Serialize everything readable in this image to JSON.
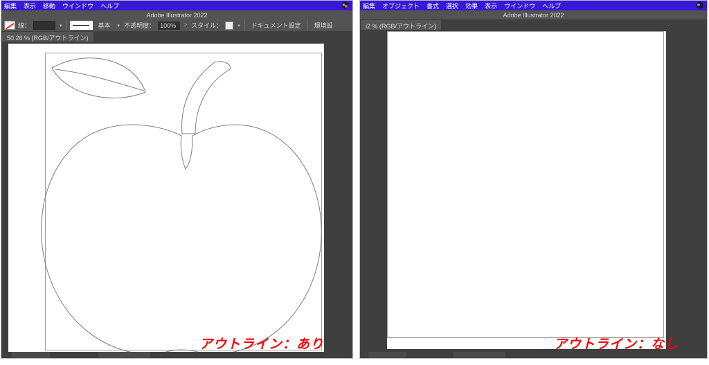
{
  "app_title": "Adobe Illustrator 2022",
  "left": {
    "menus": [
      "編集",
      "表示",
      "移動",
      "ウインドウ",
      "ヘルプ"
    ],
    "doc_tab": "50.26 % (RGB/アウトライン)",
    "opt": {
      "stroke_lbl": "線：",
      "stroke_val": "",
      "basic": "基本",
      "opacity_lbl": "不透明度：",
      "opacity_val": "100%",
      "style_lbl": "スタイル：",
      "docset": "ドキュメント設定",
      "env": "環境設"
    },
    "caption": "アウトライン：あり"
  },
  "right": {
    "menus": [
      "編集",
      "オブジェクト",
      "書式",
      "選択",
      "効果",
      "表示",
      "ウインドウ",
      "ヘルプ"
    ],
    "doc_tab": "i2 % (RGB/アウトライン)",
    "caption": "アウトライン：なし"
  }
}
